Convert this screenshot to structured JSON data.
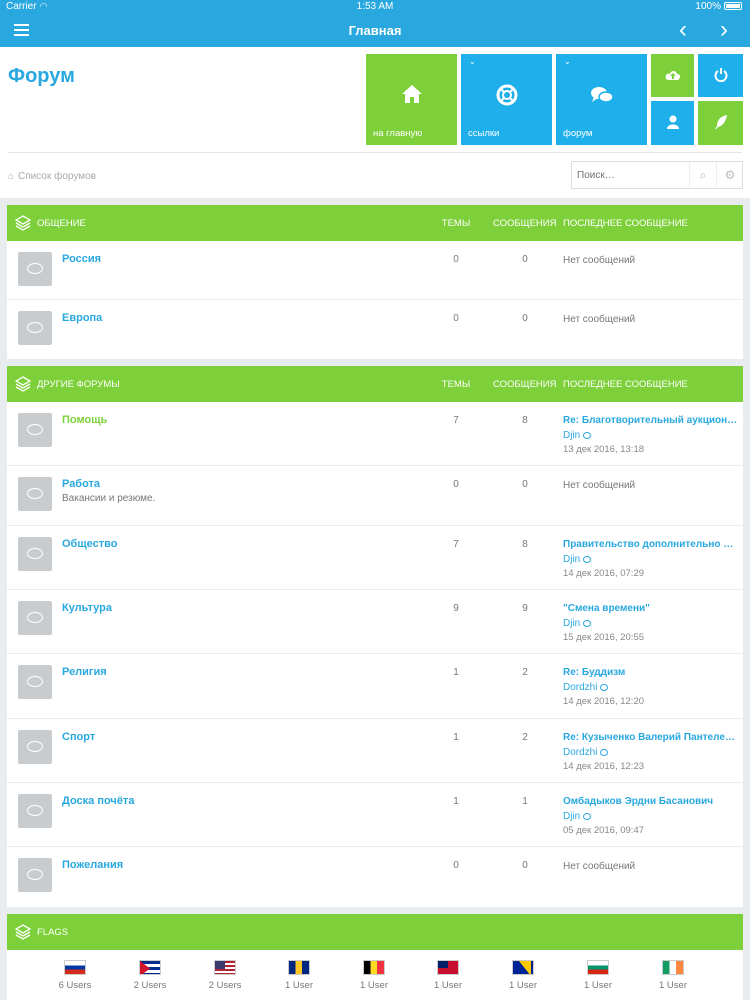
{
  "status": {
    "carrier": "Carrier",
    "time": "1:53 AM",
    "battery": "100%"
  },
  "nav": {
    "title": "Главная",
    "back": "‹",
    "forward": "›"
  },
  "header": {
    "title": "Форум",
    "tiles": [
      {
        "label": "на главную",
        "icon": "home-icon",
        "color": "#7ed03a"
      },
      {
        "label": "ссылки",
        "icon": "lifebuoy-icon",
        "color": "#1fb0ec"
      },
      {
        "label": "форум",
        "icon": "chat-icon",
        "color": "#1fb0ec"
      },
      {
        "label": "",
        "icon": "cloud-upload-icon",
        "color": "#7ed03a"
      },
      {
        "label": "",
        "icon": "power-icon",
        "color": "#1fb0ec"
      },
      {
        "label": "",
        "icon": "user-icon",
        "color": "#1fb0ec"
      },
      {
        "label": "",
        "icon": "feather-icon",
        "color": "#7ed03a"
      }
    ],
    "breadcrumb": "Список форумов",
    "search_placeholder": "Поиск…"
  },
  "columns": {
    "topics": "ТЕМЫ",
    "messages": "СООБЩЕНИЯ",
    "last": "ПОСЛЕДНЕЕ СООБЩЕНИЕ"
  },
  "sections": [
    {
      "name": "ОБЩЕНИЕ",
      "forums": [
        {
          "name": "Россия",
          "desc": "",
          "topics": "0",
          "messages": "0",
          "last_title": "",
          "last_user": "",
          "last_date": "",
          "no_messages": "Нет сообщений"
        },
        {
          "name": "Европа",
          "desc": "",
          "topics": "0",
          "messages": "0",
          "last_title": "",
          "last_user": "",
          "last_date": "",
          "no_messages": "Нет сообщений"
        }
      ]
    },
    {
      "name": "ДРУГИЕ ФОРУМЫ",
      "forums": [
        {
          "name": "Помощь",
          "desc": "",
          "topics": "7",
          "messages": "8",
          "last_title": "Re: Благотворительный аукцион…",
          "last_user": "Djin",
          "last_date": "13 дек 2016, 13:18",
          "no_messages": ""
        },
        {
          "name": "Работа",
          "desc": "Вакансии и резюме.",
          "topics": "0",
          "messages": "0",
          "last_title": "",
          "last_user": "",
          "last_date": "",
          "no_messages": "Нет сообщений"
        },
        {
          "name": "Общество",
          "desc": "",
          "topics": "7",
          "messages": "8",
          "last_title": "Правительство дополнительно п…",
          "last_user": "Djin",
          "last_date": "14 дек 2016, 07:29",
          "no_messages": ""
        },
        {
          "name": "Культура",
          "desc": "",
          "topics": "9",
          "messages": "9",
          "last_title": "\"Смена времени\"",
          "last_user": "Djin",
          "last_date": "15 дек 2016, 20:55",
          "no_messages": ""
        },
        {
          "name": "Религия",
          "desc": "",
          "topics": "1",
          "messages": "2",
          "last_title": "Re: Буддизм",
          "last_user": "Dordzhi",
          "last_date": "14 дек 2016, 12:20",
          "no_messages": ""
        },
        {
          "name": "Спорт",
          "desc": "",
          "topics": "1",
          "messages": "2",
          "last_title": "Re: Кузыченко Валерий Пантеле…",
          "last_user": "Dordzhi",
          "last_date": "14 дек 2016, 12:23",
          "no_messages": ""
        },
        {
          "name": "Доска почёта",
          "desc": "",
          "topics": "1",
          "messages": "1",
          "last_title": "Омбадыков Эрдни Басанович",
          "last_user": "Djin",
          "last_date": "05 дек 2016, 09:47",
          "no_messages": ""
        },
        {
          "name": "Пожелания",
          "desc": "",
          "topics": "0",
          "messages": "0",
          "last_title": "",
          "last_user": "",
          "last_date": "",
          "no_messages": "Нет сообщений"
        }
      ]
    }
  ],
  "flags": {
    "title": "FLAGS",
    "items": [
      {
        "country": "russia",
        "users": "6 Users"
      },
      {
        "country": "cuba",
        "users": "2 Users"
      },
      {
        "country": "usa",
        "users": "2 Users"
      },
      {
        "country": "barbados",
        "users": "1 User"
      },
      {
        "country": "belgium",
        "users": "1 User"
      },
      {
        "country": "bermuda",
        "users": "1 User"
      },
      {
        "country": "bosnia",
        "users": "1 User"
      },
      {
        "country": "bulgaria",
        "users": "1 User"
      },
      {
        "country": "ireland",
        "users": "1 User"
      }
    ]
  },
  "colors": {
    "accent_blue": "#29a8e0",
    "accent_green": "#7ed03a",
    "tile_blue": "#1fb0ec"
  }
}
